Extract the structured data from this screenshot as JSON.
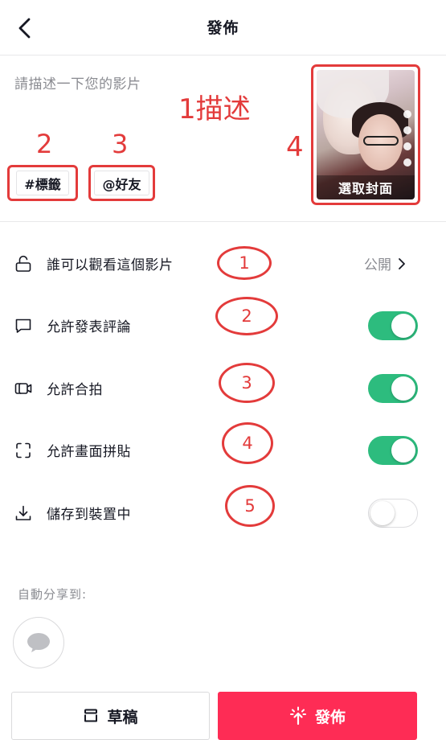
{
  "header": {
    "title": "發佈"
  },
  "description": {
    "placeholder": "請描述一下您的影片",
    "annotation": "1描述",
    "hashtag_label": "#標籤",
    "mention_label": "@好友",
    "hashtag_annotation": "2",
    "mention_annotation": "3",
    "cover_annotation": "4",
    "cover_label": "選取封面"
  },
  "settings": {
    "privacy": {
      "label": "誰可以觀看這個影片",
      "value": "公開",
      "annotation": "1"
    },
    "comments": {
      "label": "允許發表評論",
      "enabled": true,
      "annotation": "2"
    },
    "duet": {
      "label": "允許合拍",
      "enabled": true,
      "annotation": "3"
    },
    "stitch": {
      "label": "允許畫面拼貼",
      "enabled": true,
      "annotation": "4"
    },
    "save_to_device": {
      "label": "儲存到裝置中",
      "enabled": false,
      "annotation": "5"
    }
  },
  "share": {
    "label": "自動分享到:"
  },
  "footer": {
    "draft_label": "草稿",
    "post_label": "發佈"
  },
  "colors": {
    "accent": "#fe2c55",
    "toggle_on": "#2dbc7e",
    "annotation": "#e33b3b"
  }
}
